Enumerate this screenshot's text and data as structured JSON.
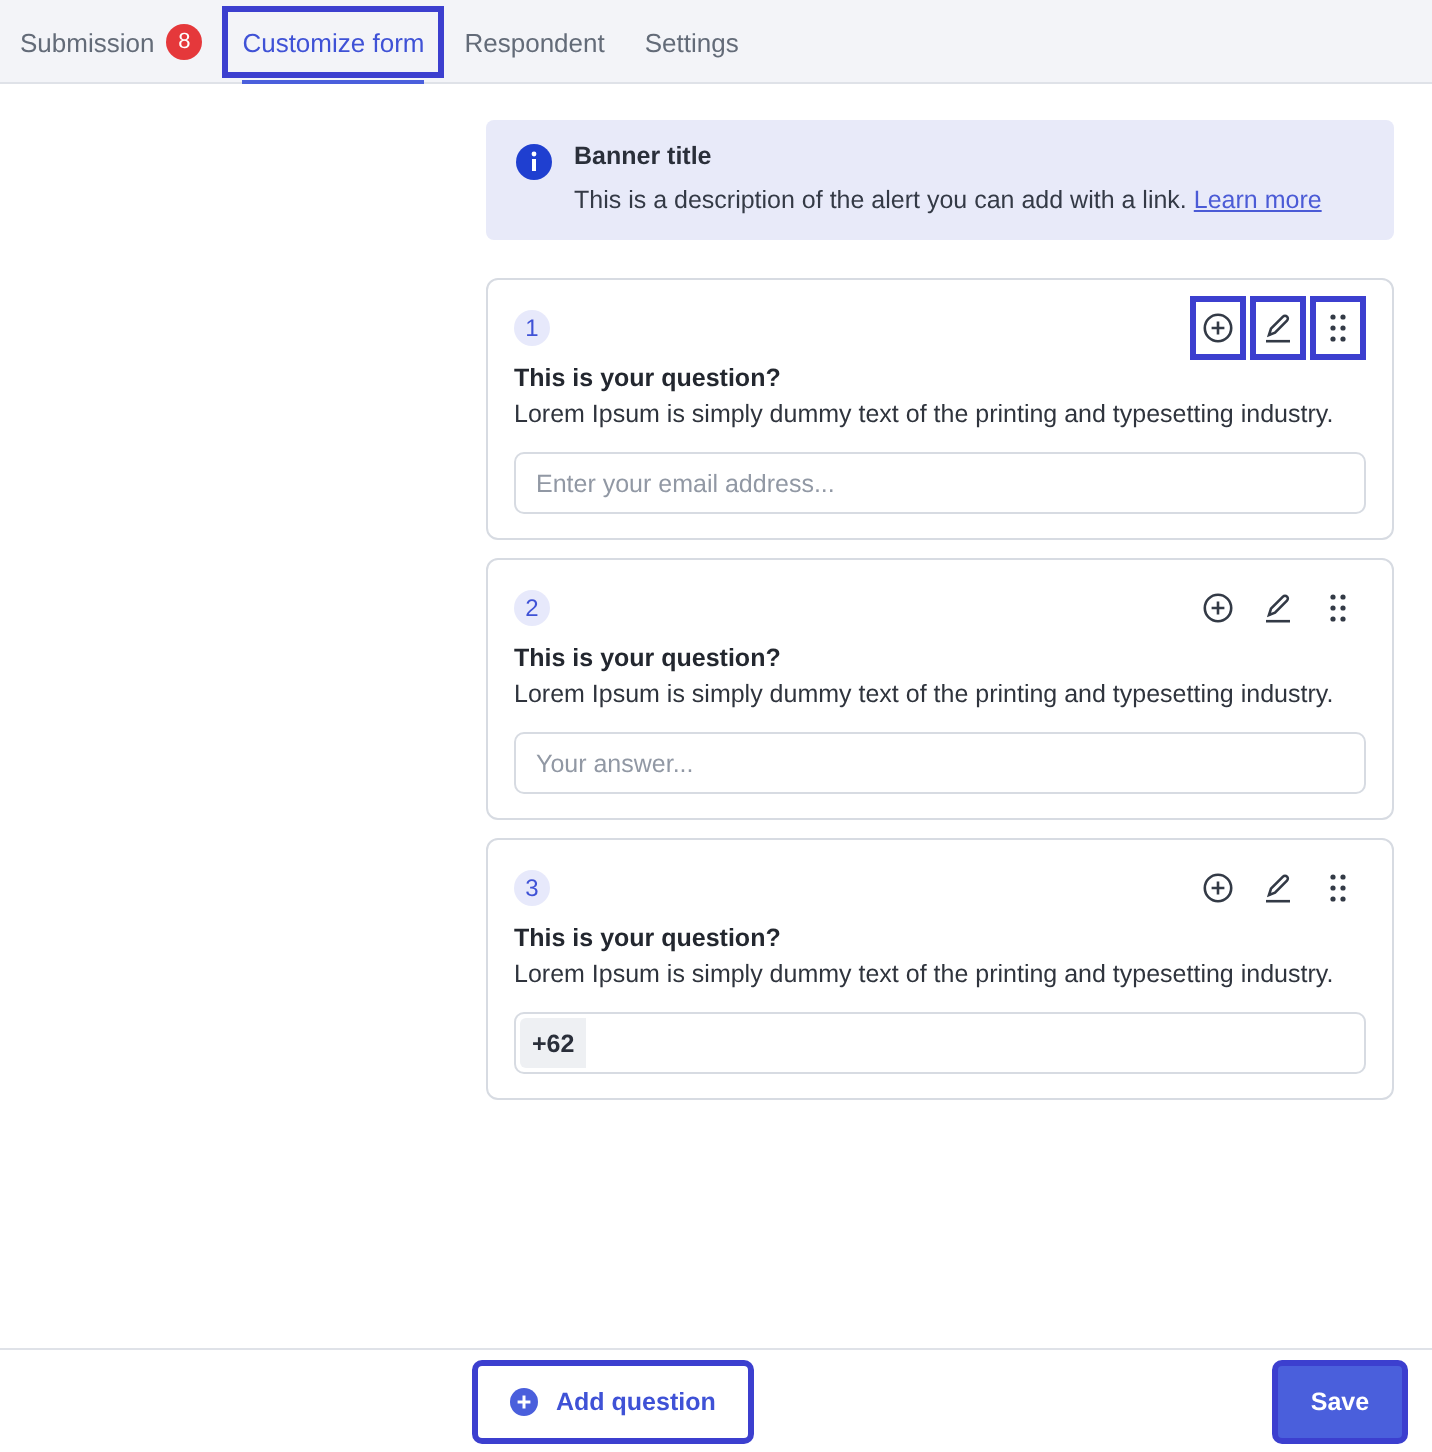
{
  "tabs": [
    {
      "label": "Submission",
      "badge": "8",
      "selected": false,
      "highlighted": false
    },
    {
      "label": "Customize form",
      "selected": true,
      "highlighted": true
    },
    {
      "label": "Respondent",
      "selected": false,
      "highlighted": false
    },
    {
      "label": "Settings",
      "selected": false,
      "highlighted": false
    }
  ],
  "banner": {
    "title": "Banner title",
    "description": "This is a description of the alert you can add with a link.",
    "link": "Learn more"
  },
  "questions": [
    {
      "number": "1",
      "title": "This is your question?",
      "description": "Lorem Ipsum is simply dummy text of the printing and typesetting industry.",
      "field": {
        "kind": "text",
        "placeholder": "Enter your email address..."
      },
      "actions_highlighted": true
    },
    {
      "number": "2",
      "title": "This is your question?",
      "description": "Lorem Ipsum is simply dummy text of the printing and typesetting industry.",
      "field": {
        "kind": "text",
        "placeholder": "Your answer..."
      },
      "actions_highlighted": false
    },
    {
      "number": "3",
      "title": "This is your question?",
      "description": "Lorem Ipsum is simply dummy text of the printing and typesetting industry.",
      "field": {
        "kind": "phone",
        "prefix": "+62"
      },
      "actions_highlighted": false
    }
  ],
  "footer": {
    "add_button": {
      "label": "Add question",
      "highlighted": true
    },
    "save_button": {
      "label": "Save",
      "highlighted": true
    }
  }
}
